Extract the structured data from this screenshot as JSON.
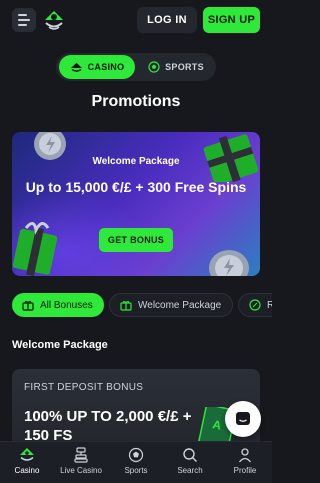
{
  "header": {
    "login_label": "LOG IN",
    "signup_label": "SIGN UP"
  },
  "toggle": {
    "casino_label": "CASINO",
    "sports_label": "SPORTS",
    "selected": "CASINO"
  },
  "page_title": "Promotions",
  "banner": {
    "subtitle": "Welcome Package",
    "title": "Up to 15,000 €/£ + 300 Free Spins",
    "button_label": "GET BONUS"
  },
  "filters": {
    "items": [
      {
        "label": "All Bonuses",
        "icon": "gift-icon",
        "active": true
      },
      {
        "label": "Welcome Package",
        "icon": "gift-icon",
        "active": false
      },
      {
        "label": "R",
        "icon": "percent-icon",
        "active": false
      }
    ]
  },
  "section_title": "Welcome Package",
  "deposit_card": {
    "label": "FIRST DEPOSIT BONUS",
    "title": "100% UP TO 2,000 €/£ + 150 FS"
  },
  "bottom_nav": {
    "items": [
      {
        "label": "Casino",
        "icon": "casino-icon",
        "active": true
      },
      {
        "label": "Live Casino",
        "icon": "live-casino-icon",
        "active": false
      },
      {
        "label": "Sports",
        "icon": "sports-ball-icon",
        "active": false
      },
      {
        "label": "Search",
        "icon": "search-icon",
        "active": false
      },
      {
        "label": "Profile",
        "icon": "profile-icon",
        "active": false
      }
    ]
  },
  "colors": {
    "accent": "#2ee83a",
    "background": "#16181d",
    "surface": "#24272e"
  }
}
